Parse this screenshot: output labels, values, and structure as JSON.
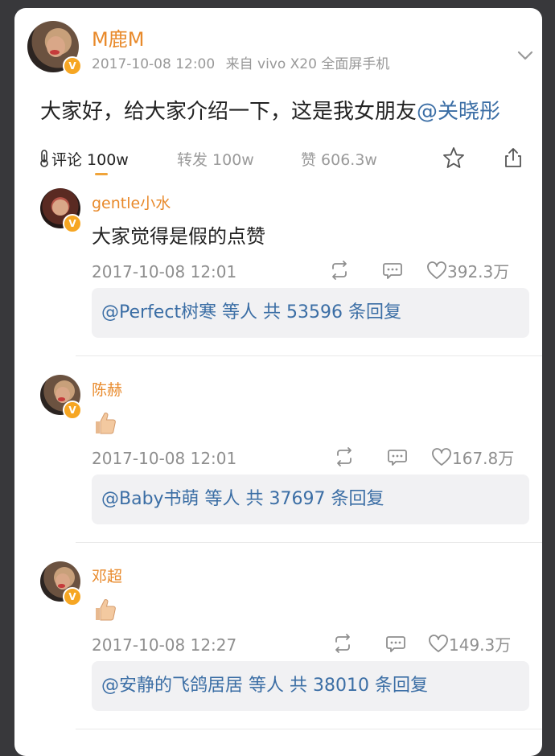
{
  "post": {
    "author": "M鹿M",
    "time": "2017-10-08 12:00",
    "source": "来自 vivo X20 全面屏手机",
    "text": "大家好，给大家介绍一下，这是我女朋友",
    "mention": "@关晓彤"
  },
  "tabs": {
    "comments": "评论 100w",
    "reposts": "转发 100w",
    "likes": "赞 606.3w"
  },
  "comments": [
    {
      "author": "gentle小水",
      "text": "大家觉得是假的点赞",
      "time": "2017-10-08 12:01",
      "likes": "392.3万",
      "replies": "@Perfect树寒  等人  共 53596 条回复"
    },
    {
      "author": "陈赫",
      "text": "",
      "emoji": "thumbs-up",
      "time": "2017-10-08 12:01",
      "likes": "167.8万",
      "replies": "@Baby书萌  等人  共 37697 条回复"
    },
    {
      "author": "邓超",
      "text": "",
      "emoji": "thumbs-up",
      "time": "2017-10-08 12:27",
      "likes": "149.3万",
      "replies": "@安静的飞鸽居居  等人  共 38010 条回复"
    }
  ],
  "colors": {
    "background": "#38383b",
    "card": "#ffffff",
    "accent_orange": "#e8892a",
    "link_blue": "#3b6ea5",
    "muted": "#8e8e8e"
  }
}
